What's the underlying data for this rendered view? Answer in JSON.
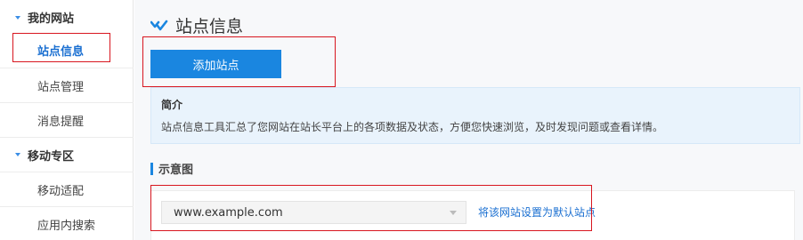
{
  "sidebar": {
    "groups": [
      {
        "label": "我的网站",
        "items": [
          {
            "label": "站点信息",
            "active": true
          },
          {
            "label": "站点管理",
            "active": false
          },
          {
            "label": "消息提醒",
            "active": false
          }
        ]
      },
      {
        "label": "移动专区",
        "items": [
          {
            "label": "移动适配",
            "active": false
          },
          {
            "label": "应用内搜索",
            "active": false
          }
        ]
      }
    ]
  },
  "main": {
    "title": "站点信息",
    "title_icon": "chevron-check-icon",
    "add_button_label": "添加站点",
    "intro": {
      "title": "简介",
      "description": "站点信息工具汇总了您网站在站长平台上的各项数据及状态，方便您快速浏览，及时发现问题或查看详情。"
    },
    "section_title": "示意图",
    "site_select_value": "www.example.com",
    "set_default_link": "将该网站设置为默认站点"
  },
  "colors": {
    "accent": "#1a86e0",
    "link": "#1a6fd1",
    "highlight_border": "#d8161f",
    "intro_bg": "#e9f3fc"
  }
}
